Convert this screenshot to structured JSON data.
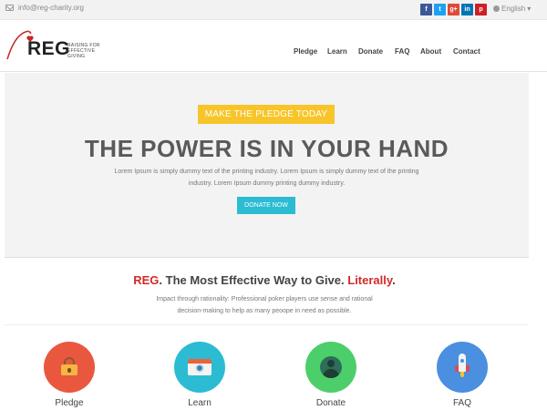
{
  "topbar": {
    "email": "info@reg-charity.org",
    "socials": [
      {
        "icon": "facebook-icon",
        "glyph": "f",
        "color": "#3b5998"
      },
      {
        "icon": "twitter-icon",
        "glyph": "t",
        "color": "#1da1f2"
      },
      {
        "icon": "google-plus-icon",
        "glyph": "g+",
        "color": "#dd4b39"
      },
      {
        "icon": "linkedin-icon",
        "glyph": "in",
        "color": "#0077b5"
      },
      {
        "icon": "pinterest-icon",
        "glyph": "p",
        "color": "#cb2027"
      }
    ],
    "language": "English"
  },
  "header": {
    "logo_text": "REG",
    "logo_tagline": "RAISING FOR EFFECTIVE GIVING",
    "nav": [
      "Pledge",
      "Learn",
      "Donate",
      "FAQ",
      "About",
      "Contact"
    ]
  },
  "hero": {
    "badge": "MAKE THE PLEDGE TODAY",
    "title": "THE POWER IS IN YOUR HAND",
    "text": "Lorem Ipsum is simply dummy text of the printing industry. Lorem Ipsum is simply dummy text of the printing industry. Lorem Ipsum dummy printing dummy industry.",
    "button": "DONATE NOW"
  },
  "mission": {
    "title_reg": "REG",
    "title_mid": ". The Most Effective Way to Give. ",
    "title_literally": "Literally",
    "title_end": ".",
    "text": "Impact through rationality: Professional poker players use sense and rational decision-making to help as many peoope in need as possible."
  },
  "features": [
    {
      "label": "Pledge",
      "color": "#e9573f",
      "icon": "lock-icon"
    },
    {
      "label": "Learn",
      "color": "#2bbcd3",
      "icon": "camera-icon"
    },
    {
      "label": "Donate",
      "color": "#4ccf6a",
      "icon": "user-icon"
    },
    {
      "label": "FAQ",
      "color": "#4a8fe0",
      "icon": "rocket-icon"
    }
  ],
  "colors": {
    "accent_yellow": "#f7c52a",
    "accent_cyan": "#2bbcd3",
    "brand_red": "#d22a2a"
  }
}
